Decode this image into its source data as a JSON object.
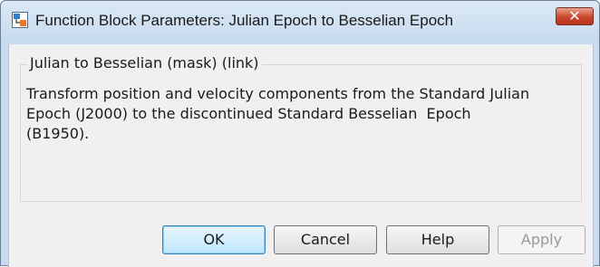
{
  "window": {
    "title": "Function Block Parameters: Julian Epoch to Besselian Epoch",
    "close_glyph": "✕"
  },
  "mask": {
    "group_title": "Julian to Besselian (mask) (link)",
    "description": "Transform position and velocity components from the Standard Julian\nEpoch (J2000) to the discontinued Standard Besselian  Epoch\n(B1950)."
  },
  "buttons": {
    "ok": "OK",
    "cancel": "Cancel",
    "help": "Help",
    "apply": "Apply"
  },
  "colors": {
    "accent": "#3c7fb1",
    "close_button": "#c9472f",
    "disabled_text": "#9a9a9a"
  },
  "icons": {
    "app": "simulink-block-icon",
    "close": "close-icon"
  }
}
